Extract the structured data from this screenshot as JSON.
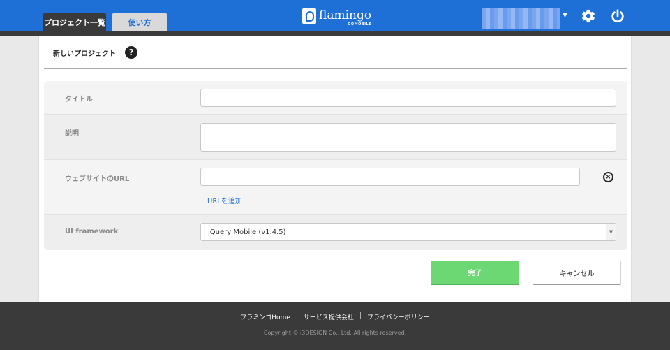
{
  "header": {
    "tabs": [
      {
        "label": "プロジェクト一覧",
        "active": true
      },
      {
        "label": "使い方",
        "active": false
      }
    ],
    "logo": {
      "name": "flamingo",
      "sub": "GOMOBILE"
    },
    "icons": {
      "user_menu": "chevron-down-icon",
      "settings": "gear-icon",
      "logout": "power-icon"
    }
  },
  "page": {
    "title": "新しいプロジェクト",
    "help_icon": "?"
  },
  "form": {
    "title_label": "タイトル",
    "title_value": "",
    "description_label": "説明",
    "description_value": "",
    "url_label": "ウェブサイトのURL",
    "url_value": "",
    "add_url_label": "URLを追加",
    "ui_label": "UI framework",
    "ui_selected": "jQuery Mobile (v1.4.5)"
  },
  "actions": {
    "done_label": "完了",
    "cancel_label": "キャンセル"
  },
  "footer": {
    "links": [
      "フラミンゴHome",
      "サービス提供会社",
      "プライバシーポリシー"
    ],
    "copyright": "Copyright © i3DESIGN Co., Ltd. All rights reserved."
  },
  "colors": {
    "header_blue": "#1e6fd6",
    "dark_bar": "#3a3a3a",
    "done_green": "#6cd874",
    "link_blue": "#1e6fd6"
  }
}
